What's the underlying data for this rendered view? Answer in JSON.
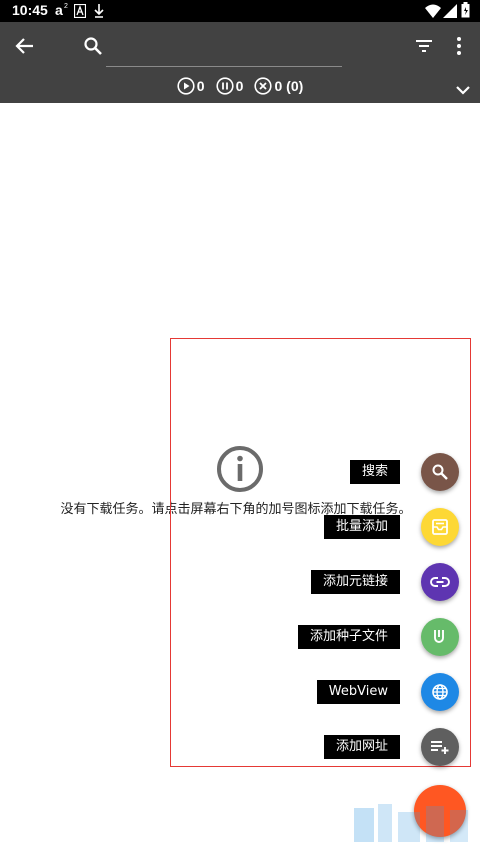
{
  "status_bar": {
    "time": "10:45",
    "icons": [
      "a-squared-icon",
      "a-box-icon",
      "download-arrow-icon",
      "wifi-icon",
      "signal-icon",
      "battery-icon"
    ]
  },
  "toolbar": {
    "search_value": "",
    "icons": [
      "back-arrow-icon",
      "search-icon",
      "filter-icon",
      "more-vert-icon",
      "chevron-down-icon"
    ],
    "counters": {
      "running": "0",
      "paused": "0",
      "error": "0 (0)"
    }
  },
  "empty_state": {
    "icon": "info-icon",
    "message": "没有下载任务。请点击屏幕右下角的加号图标添加下载任务。"
  },
  "fab_menu": [
    {
      "label": "搜索",
      "icon": "search-icon",
      "color": "#795548"
    },
    {
      "label": "批量添加",
      "icon": "batch-add-icon",
      "color": "#fdd835"
    },
    {
      "label": "添加元链接",
      "icon": "link-icon",
      "color": "#5e35b1"
    },
    {
      "label": "添加种子文件",
      "icon": "torrent-icon",
      "color": "#66bb6a"
    },
    {
      "label": "WebView",
      "icon": "globe-icon",
      "color": "#1e88e5"
    },
    {
      "label": "添加网址",
      "icon": "playlist-add-icon",
      "color": "#5f5f5f"
    }
  ],
  "main_fab": {
    "color": "#ff5722"
  },
  "colors": {
    "toolbar": "#424242",
    "status_bar": "#000000",
    "highlight_border": "#e53935"
  }
}
